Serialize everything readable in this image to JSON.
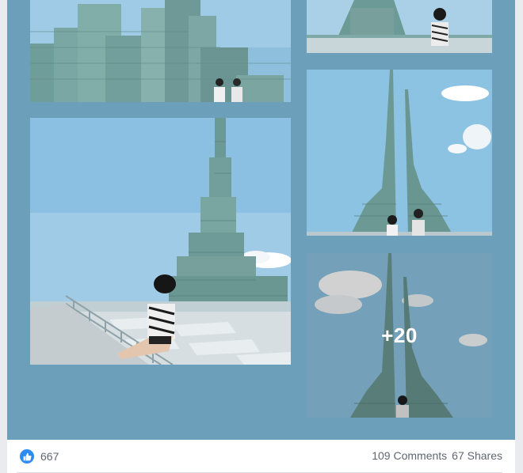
{
  "gallery": {
    "more_overlay": "+20"
  },
  "footer": {
    "reaction_icon": "thumbs-up-icon",
    "reaction_count": "667",
    "comments": "109 Comments",
    "shares": "67 Shares"
  },
  "colors": {
    "gallery_background": "#6b9fba",
    "like_blue": "#2e8bf0",
    "meta_text": "#606770"
  }
}
